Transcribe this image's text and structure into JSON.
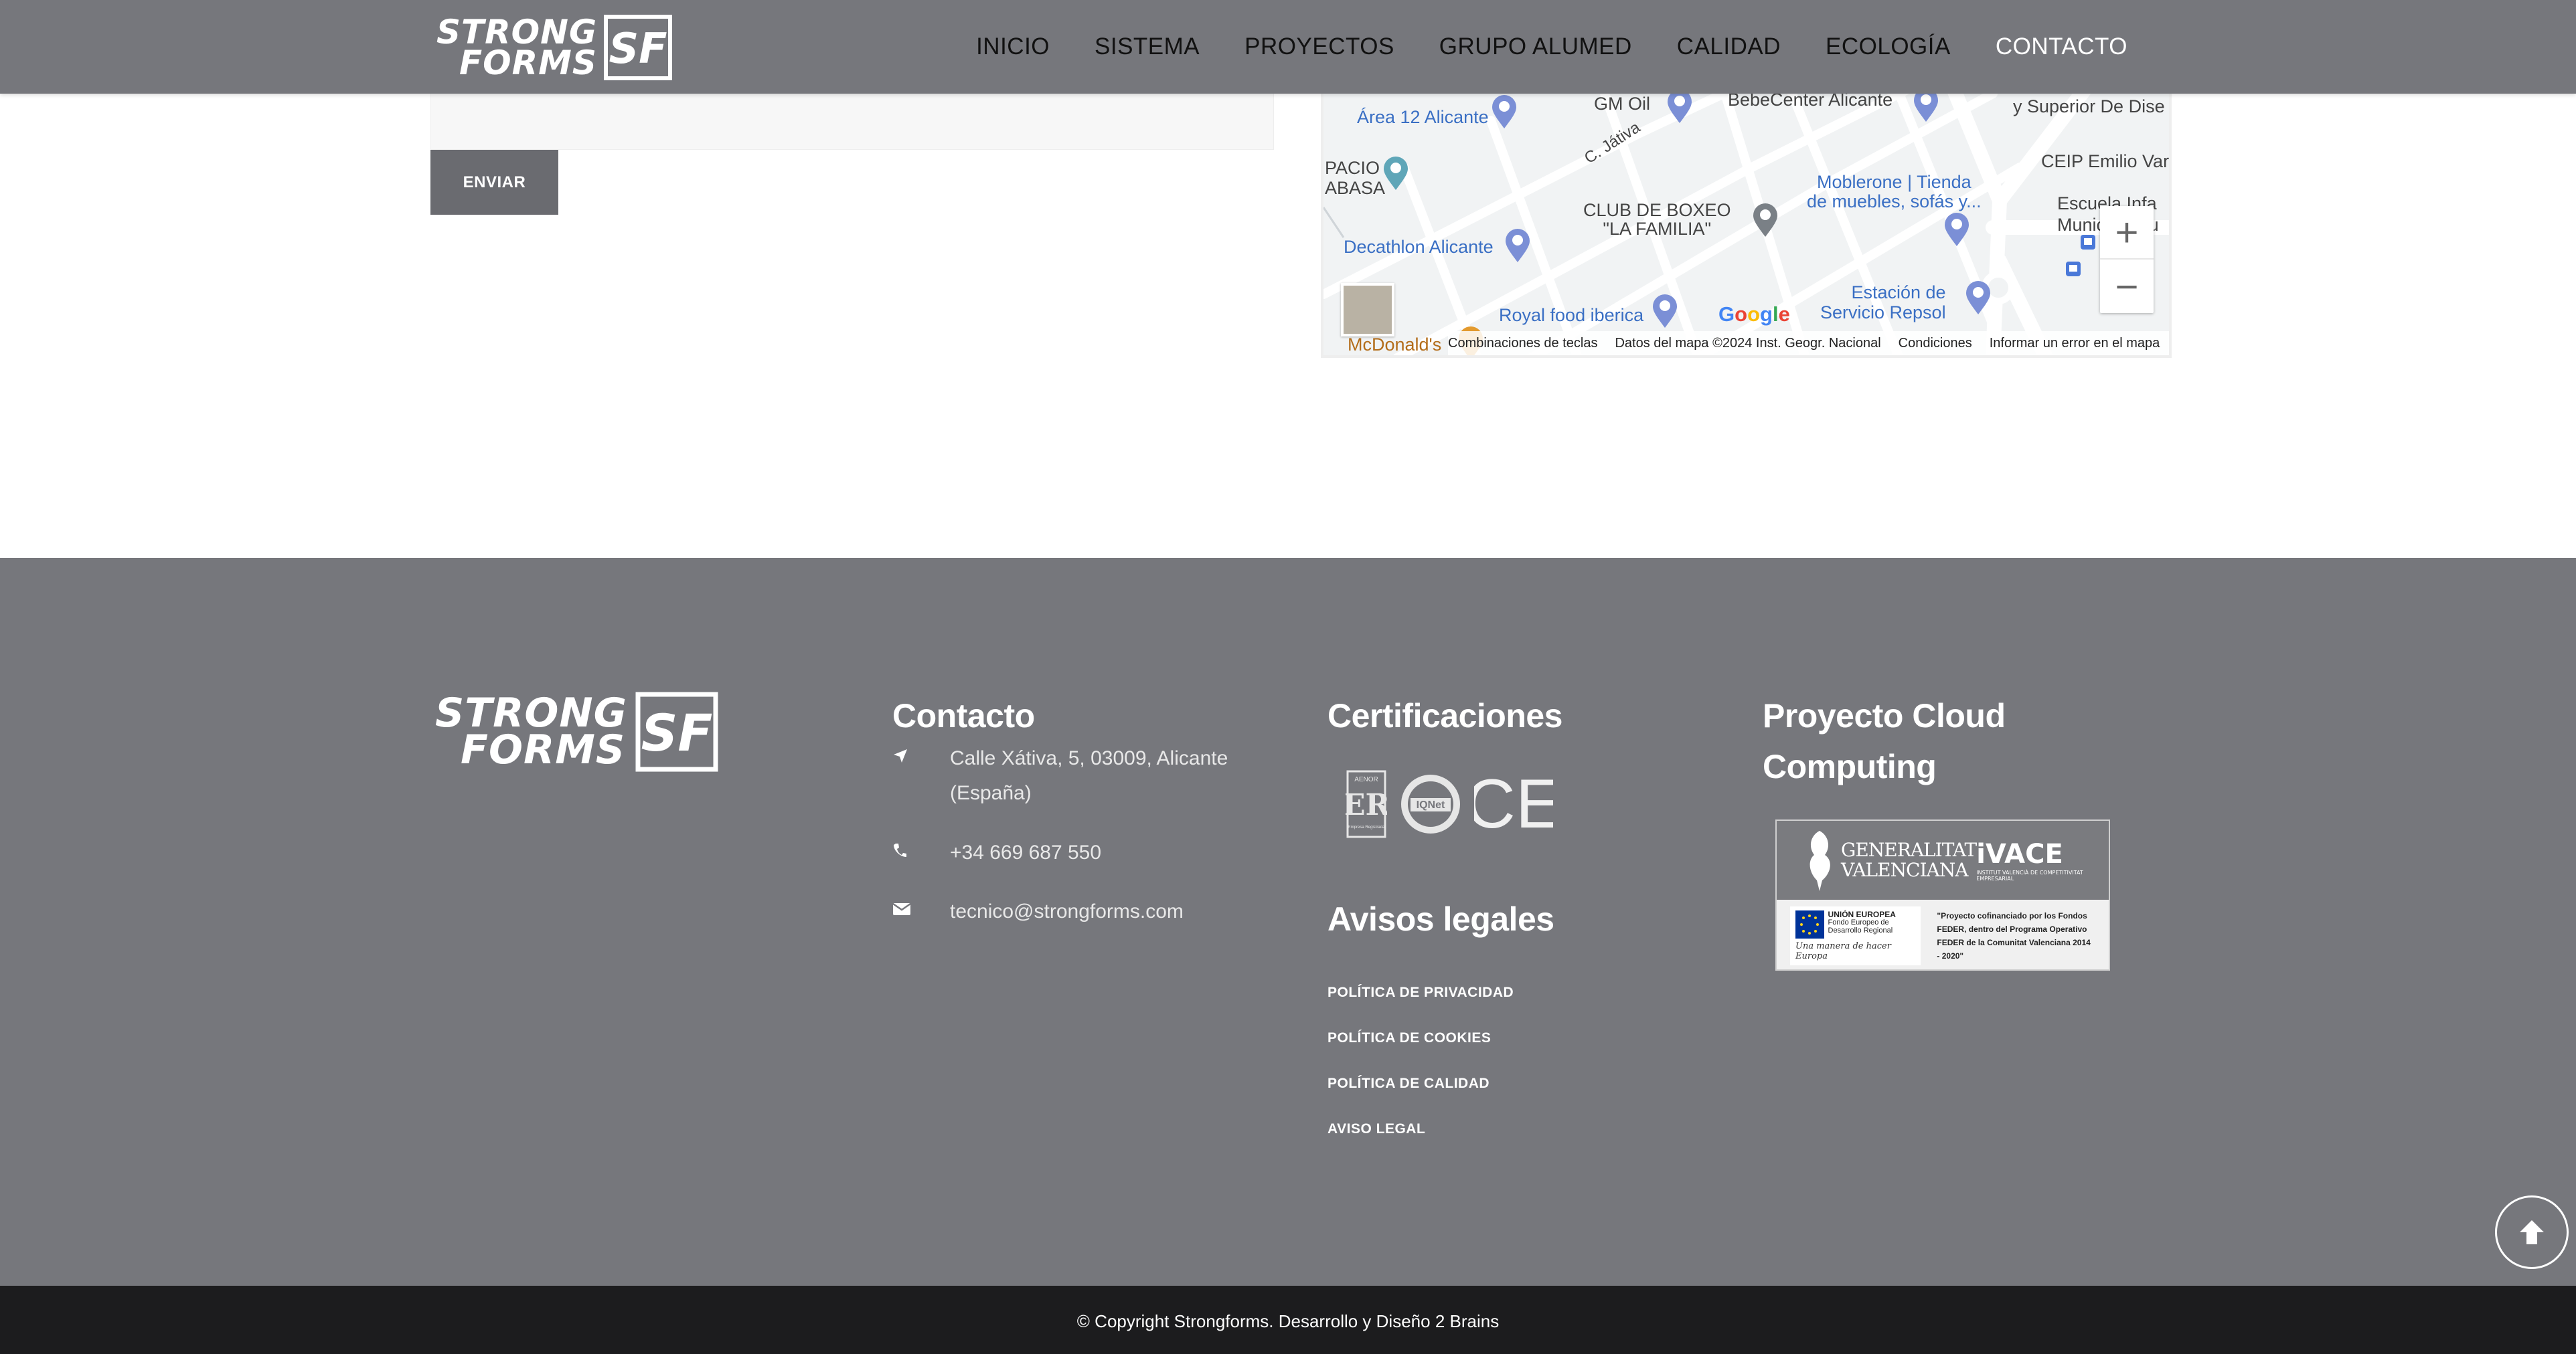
{
  "brand": {
    "logo_line1": "STRONG",
    "logo_line2": "FORMS",
    "monogram": "SF"
  },
  "nav": {
    "items": [
      "INICIO",
      "SISTEMA",
      "PROYECTOS",
      "GRUPO ALUMED",
      "CALIDAD",
      "ECOLOGÍA",
      "CONTACTO"
    ]
  },
  "form": {
    "send_label": "ENVIAR"
  },
  "map": {
    "places": {
      "area12": "Área 12 Alicante",
      "gm_oil": "GM Oil",
      "bebecenter": "BebeCenter Alicante",
      "superior": "y Superior De Dise",
      "pacio_1": "PACIO",
      "pacio_2": "ABASA",
      "street_jativa": "C. Játiva",
      "ceip": "CEIP Emilio Var",
      "moblerone_1": "Moblerone | Tienda",
      "moblerone_2": "de muebles, sofás y...",
      "escuela_1": "Escuela Infa",
      "escuela_2": "Municipal",
      "escuela_3": "qu",
      "boxeo_1": "CLUB DE BOXEO",
      "boxeo_2": "\"LA FAMILIA\"",
      "decathlon": "Decathlon Alicante",
      "estacion_1": "Estación de",
      "estacion_2": "Servicio Repsol",
      "royal": "Royal food iberica",
      "mcdonalds": "McDonald's"
    },
    "google": "Google",
    "footer_links": [
      "Combinaciones de teclas",
      "Datos del mapa ©2024 Inst. Geogr. Nacional",
      "Condiciones",
      "Informar un error en el mapa"
    ],
    "zoom_in": "+",
    "zoom_out": "−"
  },
  "footer": {
    "contact": {
      "title": "Contacto",
      "address": "Calle Xátiva, 5, 03009, Alicante (España)",
      "phone": "+34 669 687 550",
      "email": "tecnico@strongforms.com"
    },
    "certifications": {
      "title": "Certificaciones",
      "badges": {
        "aenor_top": "AENOR",
        "aenor_mark": "ER",
        "aenor_bottom": "Empresa Registrada",
        "iqnet": "IQNet",
        "ce": "CE"
      }
    },
    "legal": {
      "title": "Avisos legales",
      "links": [
        "POLÍTICA DE PRIVACIDAD",
        "POLÍTICA DE COOKIES",
        "POLÍTICA DE CALIDAD",
        "AVISO LEGAL"
      ]
    },
    "cloud": {
      "title_line1": "Proyecto Cloud",
      "title_line2": "Computing",
      "gva_line1": "GENERALITAT",
      "gva_line2": "VALENCIANA",
      "ivace": "iVACE",
      "ivace_sub": "INSTITUT VALENCIÀ DE COMPETITIVITAT EMPRESARIAL",
      "eu_title": "UNIÓN EUROPEA",
      "eu_sub": "Fondo Europeo de Desarrollo Regional",
      "eu_motto": "Una manera de hacer Europa",
      "feder_text": "\"Proyecto cofinanciado por los Fondos FEDER, dentro del Programa Operativo FEDER de la Comunitat Valenciana 2014 - 2020\""
    }
  },
  "copyright": "© Copyright Strongforms. Desarrollo y Diseño 2 Brains",
  "colors": {
    "header_bg": "#76777c",
    "footer_bg": "#76777c",
    "bottom_bar_bg": "#1c1c1e",
    "button_bg": "#6a6b70",
    "map_pin": "#7b8fd6"
  }
}
